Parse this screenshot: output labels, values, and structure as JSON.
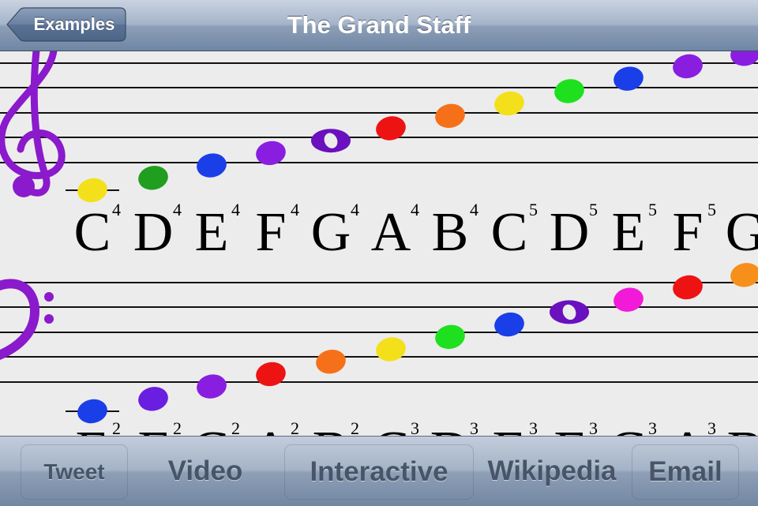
{
  "nav": {
    "back_label": "Examples",
    "title": "The Grand Staff"
  },
  "treble": {
    "clef_icon": "treble-clef-icon",
    "clef_color": "#8a1acb",
    "notes": [
      {
        "pitch": "C4",
        "color": "#f4e01a",
        "ledger": true
      },
      {
        "pitch": "D4",
        "color": "#1f9e1f"
      },
      {
        "pitch": "E4",
        "color": "#1a3ee8"
      },
      {
        "pitch": "F4",
        "color": "#8a1ee0"
      },
      {
        "pitch": "G4",
        "color": "#6a10bf",
        "whole": true
      },
      {
        "pitch": "A4",
        "color": "#ee1313"
      },
      {
        "pitch": "B4",
        "color": "#f6701a"
      },
      {
        "pitch": "C5",
        "color": "#f4e01a"
      },
      {
        "pitch": "D5",
        "color": "#1ee01e"
      },
      {
        "pitch": "E5",
        "color": "#1a3ee8"
      },
      {
        "pitch": "F5",
        "color": "#8a1ee0"
      },
      {
        "pitch": "G5",
        "color": "#8a1ee0"
      }
    ]
  },
  "bass": {
    "clef_icon": "bass-clef-icon",
    "clef_color": "#8a1acb",
    "notes": [
      {
        "pitch": "E2",
        "color": "#1a3ee8",
        "ledger": true
      },
      {
        "pitch": "F2",
        "color": "#6a1ee0"
      },
      {
        "pitch": "G2",
        "color": "#8a1ee0"
      },
      {
        "pitch": "A2",
        "color": "#ee1313"
      },
      {
        "pitch": "B2",
        "color": "#f6701a"
      },
      {
        "pitch": "C3",
        "color": "#f4e01a"
      },
      {
        "pitch": "D3",
        "color": "#1ee01e"
      },
      {
        "pitch": "E3",
        "color": "#1a3ee8"
      },
      {
        "pitch": "F3",
        "color": "#6a10bf",
        "whole": true
      },
      {
        "pitch": "G3",
        "color": "#f21ad8"
      },
      {
        "pitch": "A3",
        "color": "#ee1313"
      },
      {
        "pitch": "B3",
        "color": "#f6901a"
      }
    ]
  },
  "treble_labels": [
    {
      "letter": "C",
      "octave": "4"
    },
    {
      "letter": "D",
      "octave": "4"
    },
    {
      "letter": "E",
      "octave": "4"
    },
    {
      "letter": "F",
      "octave": "4"
    },
    {
      "letter": "G",
      "octave": "4"
    },
    {
      "letter": "A",
      "octave": "4"
    },
    {
      "letter": "B",
      "octave": "4"
    },
    {
      "letter": "C",
      "octave": "5"
    },
    {
      "letter": "D",
      "octave": "5"
    },
    {
      "letter": "E",
      "octave": "5"
    },
    {
      "letter": "F",
      "octave": "5"
    },
    {
      "letter": "G",
      "octave": ""
    }
  ],
  "bass_labels": [
    {
      "letter": "E",
      "octave": "2"
    },
    {
      "letter": "F",
      "octave": "2"
    },
    {
      "letter": "G",
      "octave": "2"
    },
    {
      "letter": "A",
      "octave": "2"
    },
    {
      "letter": "B",
      "octave": "2"
    },
    {
      "letter": "C",
      "octave": "3"
    },
    {
      "letter": "D",
      "octave": "3"
    },
    {
      "letter": "E",
      "octave": "3"
    },
    {
      "letter": "F",
      "octave": "3"
    },
    {
      "letter": "G",
      "octave": "3"
    },
    {
      "letter": "A",
      "octave": "3"
    },
    {
      "letter": "B",
      "octave": ""
    }
  ],
  "toolbar": {
    "tweet": "Tweet",
    "video": "Video",
    "interactive": "Interactive",
    "wikipedia": "Wikipedia",
    "email": "Email"
  }
}
